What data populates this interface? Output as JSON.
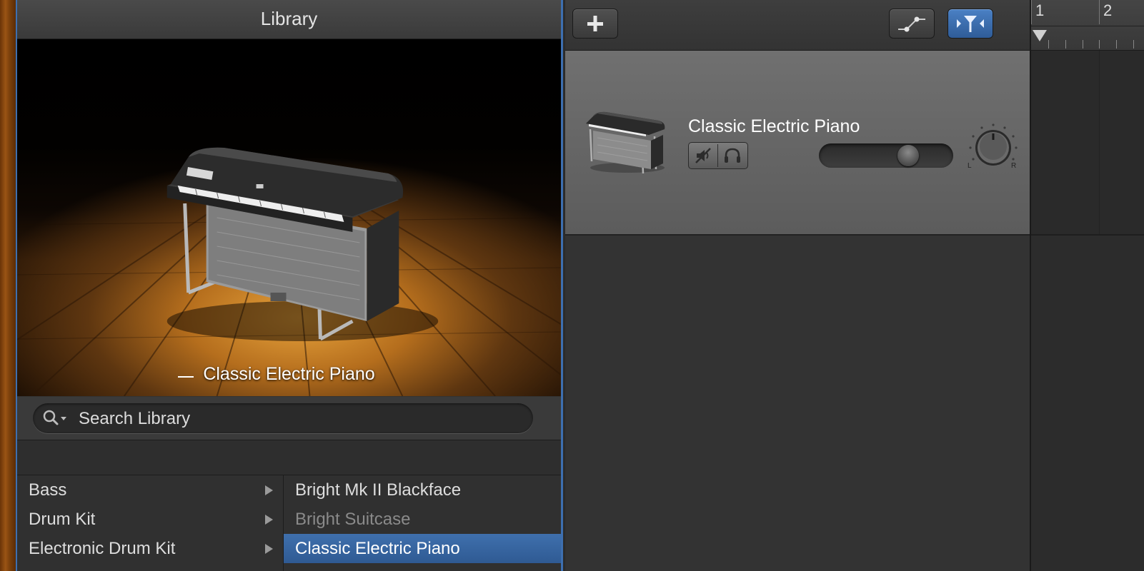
{
  "library": {
    "title": "Library",
    "preview_caption": "Classic Electric Piano",
    "search_placeholder": "Search Library",
    "categories": [
      {
        "label": "Bass"
      },
      {
        "label": "Drum Kit"
      },
      {
        "label": "Electronic Drum Kit"
      }
    ],
    "patches": [
      {
        "label": "Bright Mk II Blackface",
        "state": "normal"
      },
      {
        "label": "Bright Suitcase",
        "state": "dimmed"
      },
      {
        "label": "Classic Electric Piano",
        "state": "selected"
      }
    ]
  },
  "toolbar": {
    "add_track_icon": "plus-icon",
    "automation_icon": "automation-icon",
    "smart_controls_icon": "smart-controls-icon",
    "smart_controls_active": true
  },
  "track": {
    "name": "Classic Electric Piano",
    "mute_icon": "mute-icon",
    "solo_icon": "headphones-icon",
    "volume": 0.7,
    "pan_left_label": "L",
    "pan_right_label": "R"
  },
  "timeline": {
    "bars": [
      "1",
      "2"
    ]
  },
  "colors": {
    "selection": "#3f70ad",
    "panel_border": "#3d6fb0",
    "wood": "#9a5414"
  }
}
